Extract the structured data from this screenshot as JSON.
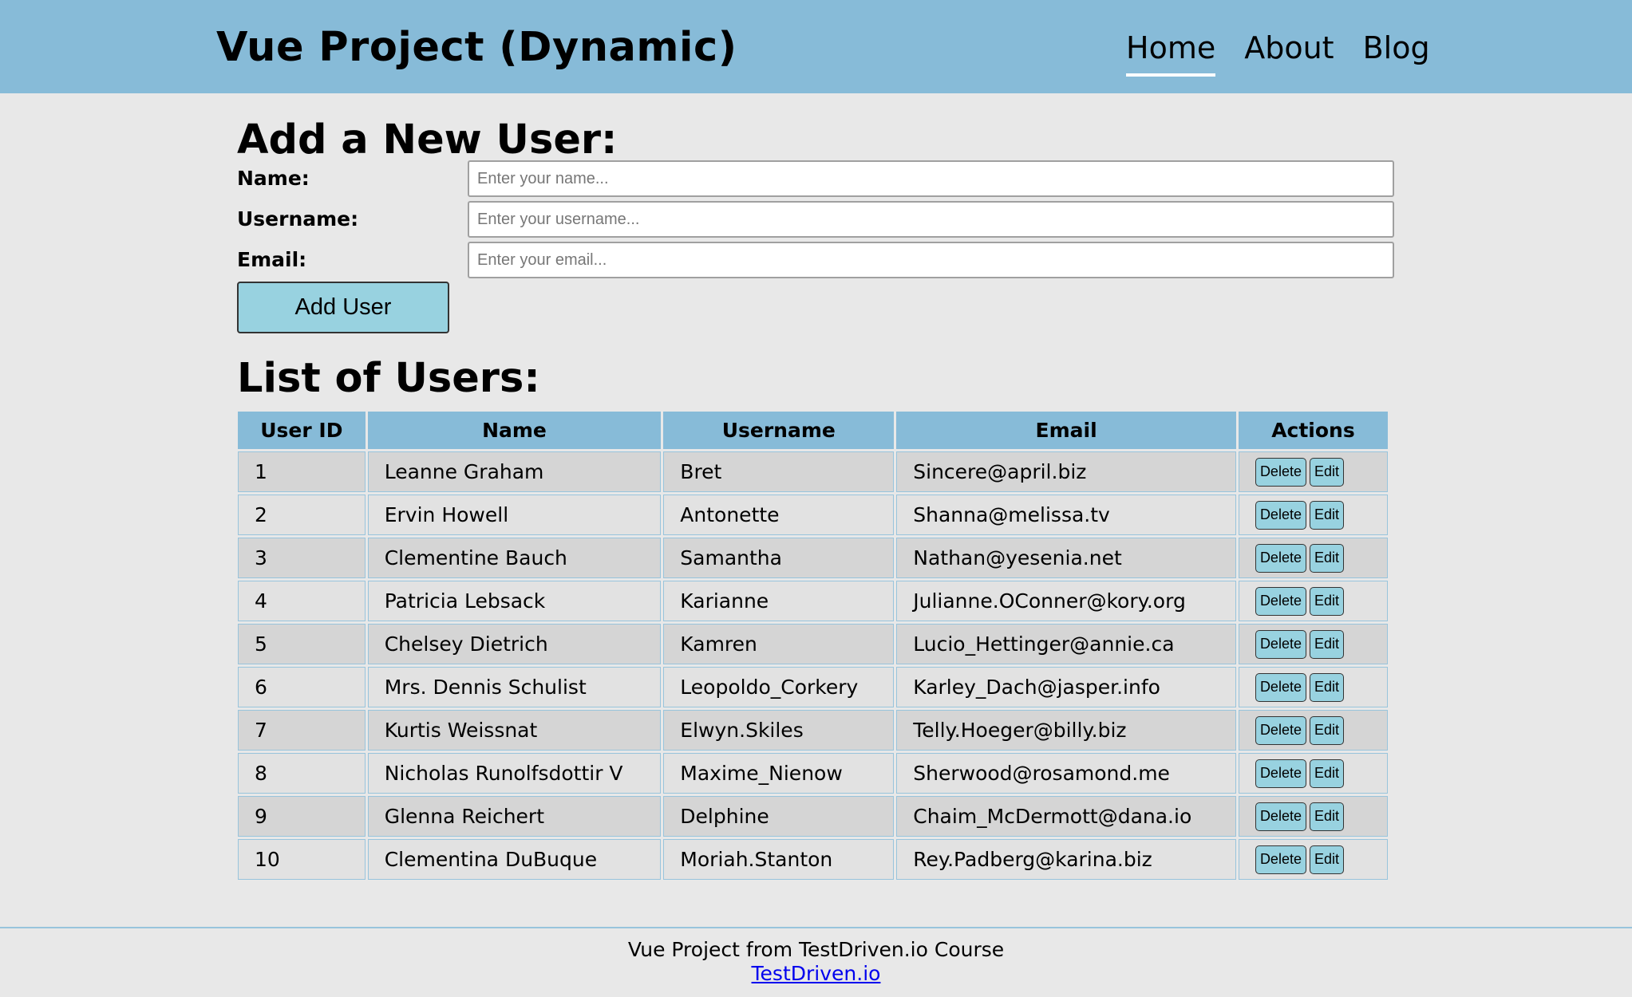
{
  "header": {
    "title": "Vue Project (Dynamic)",
    "nav": [
      {
        "label": "Home",
        "active": true
      },
      {
        "label": "About",
        "active": false
      },
      {
        "label": "Blog",
        "active": false
      }
    ]
  },
  "form": {
    "heading": "Add a New User:",
    "fields": [
      {
        "label": "Name:",
        "placeholder": "Enter your name...",
        "value": ""
      },
      {
        "label": "Username:",
        "placeholder": "Enter your username...",
        "value": ""
      },
      {
        "label": "Email:",
        "placeholder": "Enter your email...",
        "value": ""
      }
    ],
    "submit_label": "Add User"
  },
  "list": {
    "heading": "List of Users:",
    "columns": [
      "User ID",
      "Name",
      "Username",
      "Email",
      "Actions"
    ],
    "delete_label": "Delete",
    "edit_label": "Edit",
    "rows": [
      {
        "id": "1",
        "name": "Leanne Graham",
        "username": "Bret",
        "email": "Sincere@april.biz"
      },
      {
        "id": "2",
        "name": "Ervin Howell",
        "username": "Antonette",
        "email": "Shanna@melissa.tv"
      },
      {
        "id": "3",
        "name": "Clementine Bauch",
        "username": "Samantha",
        "email": "Nathan@yesenia.net"
      },
      {
        "id": "4",
        "name": "Patricia Lebsack",
        "username": "Karianne",
        "email": "Julianne.OConner@kory.org"
      },
      {
        "id": "5",
        "name": "Chelsey Dietrich",
        "username": "Kamren",
        "email": "Lucio_Hettinger@annie.ca"
      },
      {
        "id": "6",
        "name": "Mrs. Dennis Schulist",
        "username": "Leopoldo_Corkery",
        "email": "Karley_Dach@jasper.info"
      },
      {
        "id": "7",
        "name": "Kurtis Weissnat",
        "username": "Elwyn.Skiles",
        "email": "Telly.Hoeger@billy.biz"
      },
      {
        "id": "8",
        "name": "Nicholas Runolfsdottir V",
        "username": "Maxime_Nienow",
        "email": "Sherwood@rosamond.me"
      },
      {
        "id": "9",
        "name": "Glenna Reichert",
        "username": "Delphine",
        "email": "Chaim_McDermott@dana.io"
      },
      {
        "id": "10",
        "name": "Clementina DuBuque",
        "username": "Moriah.Stanton",
        "email": "Rey.Padberg@karina.biz"
      }
    ]
  },
  "footer": {
    "text": "Vue Project from TestDriven.io Course",
    "link_label": "TestDriven.io"
  },
  "colors": {
    "header_bg": "#87bbd8",
    "button_bg": "#98d2e0",
    "page_bg": "#e8e8e8",
    "link": "#0000ee"
  }
}
